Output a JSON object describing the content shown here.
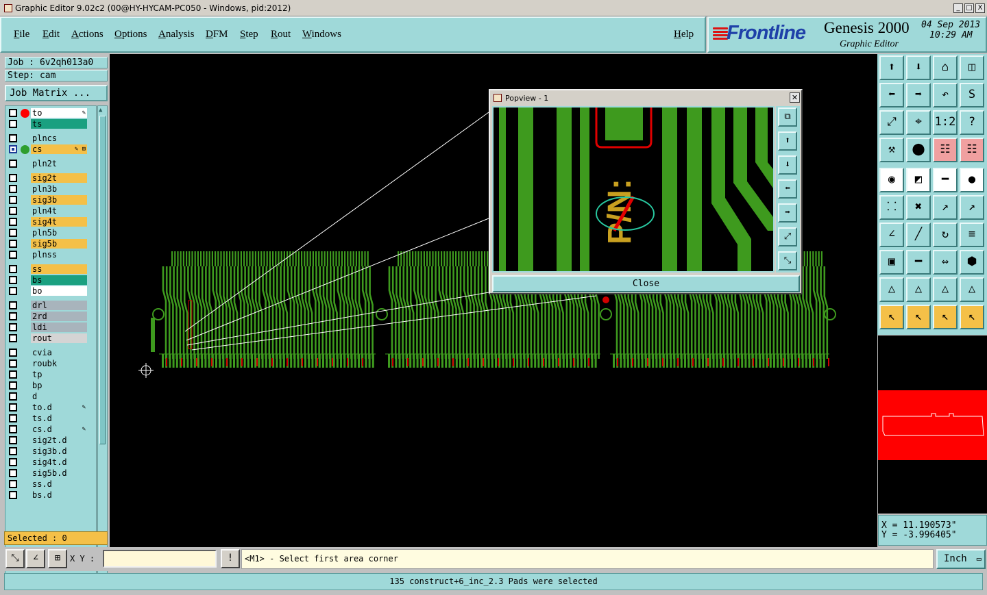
{
  "window": {
    "title": "Graphic Editor 9.02c2 (00@HY-HYCAM-PC050 - Windows, pid:2012)",
    "controls": [
      "_",
      "□",
      "X"
    ]
  },
  "menu": [
    "File",
    "Edit",
    "Actions",
    "Options",
    "Analysis",
    "DFM",
    "Step",
    "Rout",
    "Windows"
  ],
  "help_label": "Help",
  "brand": {
    "logo": "Frontline",
    "product": "Genesis 2000",
    "subtitle": "Graphic Editor",
    "date": "04 Sep 2013",
    "time": "10:29 AM"
  },
  "job": "Job : 6v2qh013a0",
  "step": "Step: cam",
  "job_matrix_label": "Job Matrix ...",
  "layers": [
    {
      "name": "to",
      "color": "#ffffff",
      "dot": "#ff0000",
      "mark": "✎",
      "checked": false
    },
    {
      "name": "ts",
      "color": "#1aa080",
      "dot": null,
      "mark": "",
      "checked": false
    },
    {
      "name": "plncs",
      "color": "#9fd9d9",
      "dot": null,
      "mark": "",
      "checked": false
    },
    {
      "name": "cs",
      "color": "#f4c048",
      "dot": "#2e9e2e",
      "mark": "✎ ⊞",
      "checked": true
    },
    {
      "name": "pln2t",
      "color": "#9fd9d9",
      "dot": null,
      "mark": "",
      "checked": false
    },
    {
      "name": "sig2t",
      "color": "#f4c048",
      "dot": null,
      "mark": "",
      "checked": false
    },
    {
      "name": "pln3b",
      "color": "#9fd9d9",
      "dot": null,
      "mark": "",
      "checked": false
    },
    {
      "name": "sig3b",
      "color": "#f4c048",
      "dot": null,
      "mark": "",
      "checked": false
    },
    {
      "name": "pln4t",
      "color": "#9fd9d9",
      "dot": null,
      "mark": "",
      "checked": false
    },
    {
      "name": "sig4t",
      "color": "#f4c048",
      "dot": null,
      "mark": "",
      "checked": false
    },
    {
      "name": "pln5b",
      "color": "#9fd9d9",
      "dot": null,
      "mark": "",
      "checked": false
    },
    {
      "name": "sig5b",
      "color": "#f4c048",
      "dot": null,
      "mark": "",
      "checked": false
    },
    {
      "name": "plnss",
      "color": "#9fd9d9",
      "dot": null,
      "mark": "",
      "checked": false
    },
    {
      "name": "ss",
      "color": "#f4c048",
      "dot": null,
      "mark": "",
      "checked": false
    },
    {
      "name": "bs",
      "color": "#1aa080",
      "dot": null,
      "mark": "",
      "checked": false
    },
    {
      "name": "bo",
      "color": "#ffffff",
      "dot": null,
      "mark": "",
      "checked": false
    },
    {
      "name": "drl",
      "color": "#a8b4bc",
      "dot": null,
      "mark": "",
      "checked": false
    },
    {
      "name": "2rd",
      "color": "#a8b4bc",
      "dot": null,
      "mark": "",
      "checked": false
    },
    {
      "name": "ldi",
      "color": "#a8b4bc",
      "dot": null,
      "mark": "",
      "checked": false
    },
    {
      "name": "rout",
      "color": "#d4d4d4",
      "dot": null,
      "mark": "",
      "checked": false
    },
    {
      "name": "cvia",
      "color": "#9fd9d9",
      "dot": null,
      "mark": "",
      "checked": false
    },
    {
      "name": "roubk",
      "color": "#9fd9d9",
      "dot": null,
      "mark": "",
      "checked": false
    },
    {
      "name": "tp",
      "color": "#9fd9d9",
      "dot": null,
      "mark": "",
      "checked": false
    },
    {
      "name": "bp",
      "color": "#9fd9d9",
      "dot": null,
      "mark": "",
      "checked": false
    },
    {
      "name": "d",
      "color": "#9fd9d9",
      "dot": null,
      "mark": "",
      "checked": false
    },
    {
      "name": "to.d",
      "color": "#9fd9d9",
      "dot": null,
      "mark": "✎",
      "checked": false
    },
    {
      "name": "ts.d",
      "color": "#9fd9d9",
      "dot": null,
      "mark": "",
      "checked": false
    },
    {
      "name": "cs.d",
      "color": "#9fd9d9",
      "dot": null,
      "mark": "✎",
      "checked": false
    },
    {
      "name": "sig2t.d",
      "color": "#9fd9d9",
      "dot": null,
      "mark": "",
      "checked": false
    },
    {
      "name": "sig3b.d",
      "color": "#9fd9d9",
      "dot": null,
      "mark": "",
      "checked": false
    },
    {
      "name": "sig4t.d",
      "color": "#9fd9d9",
      "dot": null,
      "mark": "",
      "checked": false
    },
    {
      "name": "sig5b.d",
      "color": "#9fd9d9",
      "dot": null,
      "mark": "",
      "checked": false
    },
    {
      "name": "ss.d",
      "color": "#9fd9d9",
      "dot": null,
      "mark": "",
      "checked": false
    },
    {
      "name": "bs.d",
      "color": "#9fd9d9",
      "dot": null,
      "mark": "",
      "checked": false
    }
  ],
  "selected": "Selected : 0",
  "popview": {
    "title": "Popview - 1",
    "close_label": "Close",
    "text_on_board": "P/N:",
    "buttons": [
      "zoom-window-icon",
      "pan-up-icon",
      "pan-down-icon",
      "pan-left-icon",
      "pan-right-icon",
      "fit-all-icon",
      "zoom-fit-icon"
    ]
  },
  "toolbar": [
    {
      "icon": "pan-up-icon",
      "glyph": "⬆",
      "style": ""
    },
    {
      "icon": "pan-down-icon",
      "glyph": "⬇",
      "style": ""
    },
    {
      "icon": "home-icon",
      "glyph": "⌂",
      "style": ""
    },
    {
      "icon": "window-icon",
      "glyph": "◫",
      "style": ""
    },
    {
      "icon": "pan-left-icon",
      "glyph": "⬅",
      "style": ""
    },
    {
      "icon": "pan-right-icon",
      "glyph": "➡",
      "style": ""
    },
    {
      "icon": "undo-view-icon",
      "glyph": "↶",
      "style": ""
    },
    {
      "icon": "redraw-icon",
      "glyph": "S",
      "style": ""
    },
    {
      "icon": "zoom-fit-icon",
      "glyph": "⤢",
      "style": ""
    },
    {
      "icon": "zoom-center-icon",
      "glyph": "⌖",
      "style": ""
    },
    {
      "icon": "scale-one-to-two-icon",
      "glyph": "1:2",
      "style": ""
    },
    {
      "icon": "help-icon",
      "glyph": "?",
      "style": ""
    },
    {
      "icon": "measure-tool-icon",
      "glyph": "⚒",
      "style": ""
    },
    {
      "icon": "snap-tool-icon",
      "glyph": "⬤",
      "style": ""
    },
    {
      "icon": "net-highlight-icon",
      "glyph": "☷",
      "style": "pink"
    },
    {
      "icon": "net-highlight-alt-icon",
      "glyph": "☷",
      "style": "pink"
    },
    {
      "icon": "add-pad-icon",
      "glyph": "◉",
      "style": "white"
    },
    {
      "icon": "color-fill-icon",
      "glyph": "◩",
      "style": "white"
    },
    {
      "icon": "ruler-icon",
      "glyph": "━",
      "style": "white"
    },
    {
      "icon": "circle-pad-icon",
      "glyph": "●",
      "style": "white"
    },
    {
      "icon": "connect-pads-icon",
      "glyph": "⸬",
      "style": ""
    },
    {
      "icon": "cross-select-icon",
      "glyph": "✖",
      "style": ""
    },
    {
      "icon": "move-pad-icon",
      "glyph": "↗",
      "style": ""
    },
    {
      "icon": "move-pad-alt-icon",
      "glyph": "↗",
      "style": ""
    },
    {
      "icon": "draw-angle-icon",
      "glyph": "∠",
      "style": ""
    },
    {
      "icon": "draw-line-icon",
      "glyph": "╱",
      "style": ""
    },
    {
      "icon": "arc-icon",
      "glyph": "↻",
      "style": ""
    },
    {
      "icon": "flip-icon",
      "glyph": "≡",
      "style": ""
    },
    {
      "icon": "pad-snap-icon",
      "glyph": "▣",
      "style": ""
    },
    {
      "icon": "horizontal-line-icon",
      "glyph": "━",
      "style": ""
    },
    {
      "icon": "dimension-icon",
      "glyph": "⇔",
      "style": ""
    },
    {
      "icon": "pad-group-icon",
      "glyph": "⬢",
      "style": ""
    },
    {
      "icon": "triangle-outline-icon",
      "glyph": "△",
      "style": ""
    },
    {
      "icon": "triangle-select-icon",
      "glyph": "△",
      "style": ""
    },
    {
      "icon": "triangle-edit-icon",
      "glyph": "△",
      "style": ""
    },
    {
      "icon": "triangle-move-icon",
      "glyph": "△",
      "style": ""
    },
    {
      "icon": "select-pointer-icon",
      "glyph": "↖",
      "style": "orange"
    },
    {
      "icon": "select-pointer-box-icon",
      "glyph": "↖",
      "style": "orange"
    },
    {
      "icon": "select-pointer-circle-icon",
      "glyph": "↖",
      "style": "orange"
    },
    {
      "icon": "select-pointer-path-icon",
      "glyph": "↖",
      "style": "orange"
    }
  ],
  "coords": {
    "x": "X = 11.190573\"",
    "y": "Y = -3.996405\""
  },
  "xy_label": "X Y :",
  "xy_value": "",
  "prompt": "<M1> - Select first area corner",
  "unit": "Inch",
  "status": "135 construct+6_inc_2.3 Pads were selected",
  "colors": {
    "cyan": "#9fd9d9",
    "trace_green": "#3e9a1e",
    "pad_red": "#d00000",
    "overview_red": "#ff0000"
  }
}
